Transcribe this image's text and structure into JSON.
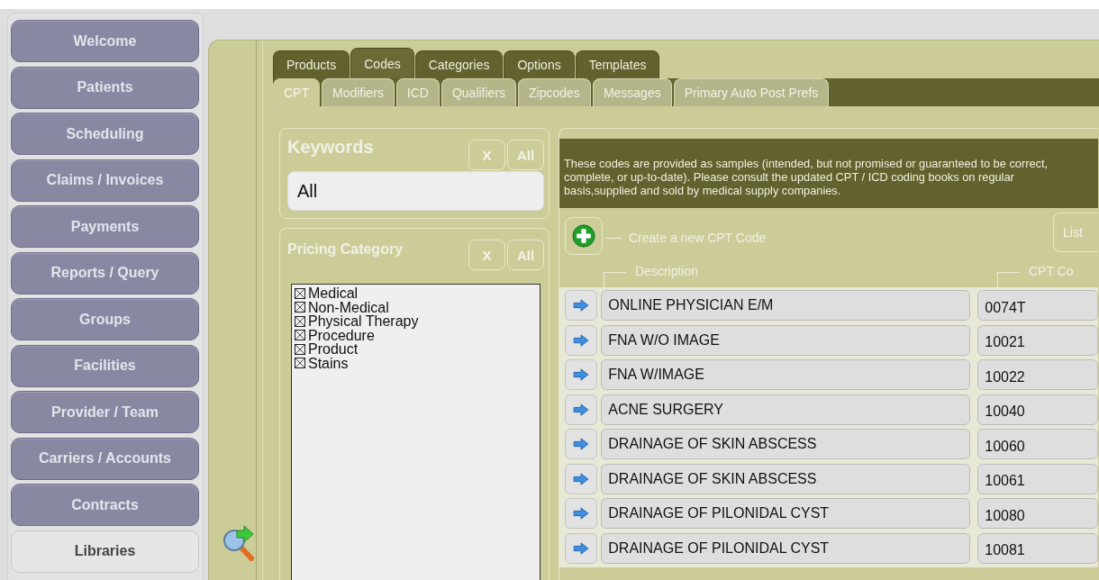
{
  "nav": [
    {
      "label": "Welcome",
      "selected": false
    },
    {
      "label": "Patients",
      "selected": false
    },
    {
      "label": "Scheduling",
      "selected": false
    },
    {
      "label": "Claims / Invoices",
      "selected": false
    },
    {
      "label": "Payments",
      "selected": false
    },
    {
      "label": "Reports / Query",
      "selected": false
    },
    {
      "label": "Groups",
      "selected": false
    },
    {
      "label": "Facilities",
      "selected": false
    },
    {
      "label": "Provider / Team",
      "selected": false
    },
    {
      "label": "Carriers / Accounts",
      "selected": false
    },
    {
      "label": "Contracts",
      "selected": false
    },
    {
      "label": "Libraries",
      "selected": true
    }
  ],
  "tabs": [
    {
      "label": "Products",
      "selected": false
    },
    {
      "label": "Codes",
      "selected": true
    },
    {
      "label": "Categories",
      "selected": false
    },
    {
      "label": "Options",
      "selected": false
    },
    {
      "label": "Templates",
      "selected": false
    }
  ],
  "subtabs": [
    {
      "label": "CPT",
      "selected": true
    },
    {
      "label": "Modifiers",
      "selected": false
    },
    {
      "label": "ICD",
      "selected": false
    },
    {
      "label": "Qualifiers",
      "selected": false
    },
    {
      "label": "Zipcodes",
      "selected": false
    },
    {
      "label": "Messages",
      "selected": false
    },
    {
      "label": "Primary Auto Post Prefs",
      "selected": false
    }
  ],
  "keywords": {
    "title": "Keywords",
    "clear": "X",
    "all": "All",
    "value": "All"
  },
  "pricing": {
    "title": "Pricing Category",
    "clear": "X",
    "all": "All",
    "items": [
      {
        "label": "Medical",
        "checked": true
      },
      {
        "label": "Non-Medical",
        "checked": true
      },
      {
        "label": "Physical Therapy",
        "checked": true
      },
      {
        "label": "Procedure",
        "checked": true
      },
      {
        "label": "Product",
        "checked": true
      },
      {
        "label": "Stains",
        "checked": true
      }
    ]
  },
  "notice": "These codes are provided as samples (intended, but not promised or guaranteed to be correct, complete, or up-to-date). Please consult the updated CPT / ICD coding books on regular basis,supplied and sold by medical supply companies.",
  "toolbar": {
    "create": "Create a new CPT Code",
    "list": "List"
  },
  "columns": [
    "Description",
    "CPT Co"
  ],
  "rows": [
    {
      "description": "ONLINE PHYSICIAN E/M",
      "code": "0074T"
    },
    {
      "description": "FNA W/O IMAGE",
      "code": "10021"
    },
    {
      "description": "FNA W/IMAGE",
      "code": "10022"
    },
    {
      "description": "ACNE SURGERY",
      "code": "10040"
    },
    {
      "description": "DRAINAGE OF SKIN ABSCESS",
      "code": "10060"
    },
    {
      "description": "DRAINAGE OF SKIN ABSCESS",
      "code": "10061"
    },
    {
      "description": "DRAINAGE OF PILONIDAL CYST",
      "code": "10080"
    },
    {
      "description": "DRAINAGE OF PILONIDAL CYST",
      "code": "10081"
    }
  ]
}
